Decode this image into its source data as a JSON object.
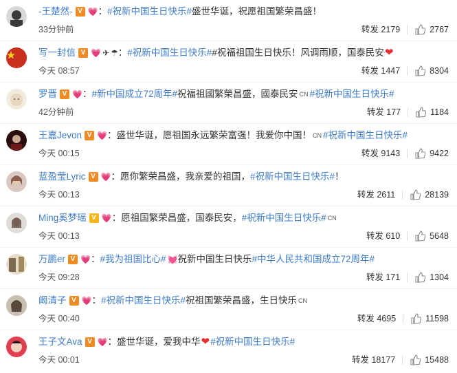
{
  "labels": {
    "repost_prefix": "转发"
  },
  "posts": [
    {
      "user": "-王楚然-",
      "avatar_color": "#3a3a3a",
      "tag": "#祝新中国生日快乐#",
      "text_after": " 盛世华诞，祝愿祖国繁荣昌盛！",
      "time": "33分钟前",
      "repost": "转发 2179",
      "likes": "2767"
    },
    {
      "user": "写一封信",
      "avatar_color": "#c8301f",
      "tag": "#祝新中国生日快乐#",
      "text_after": "#祝福祖国生日快乐！风调雨顺，国泰民安",
      "time": "今天 08:57",
      "repost": "转发 1447",
      "likes": "8304"
    },
    {
      "user": "罗晋",
      "avatar_color": "#e8d8c0",
      "tag": "#新中国成立72周年#",
      "text_after": " 祝福祖國繁榮昌盛，國泰民安",
      "tag2": "#祝新中国生日快乐#",
      "time": "42分钟前",
      "repost": "转发 177",
      "likes": "1184"
    },
    {
      "user": "王嘉Jevon",
      "avatar_color": "#4a1a1a",
      "text_before": "：盛世华诞，愿祖国永远繁荣富强！我爱你中国！",
      "tag": "#祝新中国生日快乐#",
      "time": "今天 00:15",
      "repost": "转发 9143",
      "likes": "9422"
    },
    {
      "user": "蓝盈莹Lyric",
      "avatar_color": "#b08a78",
      "text_before": "：愿你繁荣昌盛，我亲爱的祖国，",
      "tag": "#祝新中国生日快乐#",
      "text_after": "！",
      "time": "今天 00:13",
      "repost": "转发 2611",
      "likes": "28139"
    },
    {
      "user": "Ming奚梦瑶",
      "avatar_color": "#7a6a60",
      "text_before": "：愿祖国繁荣昌盛，国泰民安，",
      "tag": "#祝新中国生日快乐#",
      "time": "今天 00:13",
      "repost": "转发 610",
      "likes": "5648"
    },
    {
      "user": "万鹏er",
      "avatar_color": "#6a5a40",
      "tag": "#我为祖国比心#",
      "text_after": "祝新中国生日快乐",
      "tag2": "#中华人民共和国成立72周年#",
      "time": "今天 09:28",
      "repost": "转发 171",
      "likes": "1304"
    },
    {
      "user": "阚清子",
      "avatar_color": "#5a4a3a",
      "tag": "#祝新中国生日快乐#",
      "text_after": " 祝祖国繁荣昌盛，生日快乐",
      "time": "今天 00:40",
      "repost": "转发 4695",
      "likes": "11598"
    },
    {
      "user": "王子文Ava",
      "avatar_color": "#c04050",
      "text_before": "：盛世华诞，爱我中华",
      "tag": "#祝新中国生日快乐#",
      "time": "今天 00:01",
      "repost": "转发 18177",
      "likes": "15488"
    }
  ]
}
